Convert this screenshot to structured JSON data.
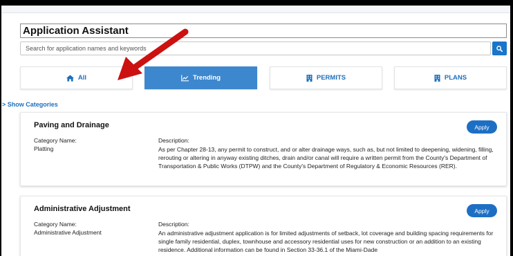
{
  "header": {
    "title": "Application Assistant"
  },
  "search": {
    "placeholder": "Search for application names and keywords"
  },
  "tabs": [
    {
      "label": "All",
      "icon": "home-icon"
    },
    {
      "label": "Trending",
      "icon": "chart-line-icon"
    },
    {
      "label": "PERMITS",
      "icon": "building-icon"
    },
    {
      "label": "PLANS",
      "icon": "building-icon"
    }
  ],
  "show_categories": "> Show Categories",
  "cards": [
    {
      "title": "Paving and Drainage",
      "apply_label": "Apply",
      "category_label": "Category Name:",
      "category_value": "Platting",
      "description_label": "Description:",
      "description": "As per Chapter 28-13, any permit to construct, and or alter drainage ways, such as, but not limited to deepening, widening, filling, rerouting or altering in anyway existing ditches, drain and/or canal will require a written permit from the County's Department of Transportation & Public Works (DTPW) and the County's Department of Regulatory & Economic Resources (RER)."
    },
    {
      "title": "Administrative Adjustment",
      "apply_label": "Apply",
      "category_label": "Category Name:",
      "category_value": "Administrative Adjustment",
      "description_label": "Description:",
      "description": "An administrative adjustment application is for limited adjustments of setback, lot coverage and building spacing requirements for single family residential, duplex, townhouse and accessory residential uses for new construction or an addition to an existing residence. Additional information can be found in Section 33-36.1 of the Miami-Dade"
    }
  ],
  "colors": {
    "accent": "#1d6fc4",
    "active_tab": "#3d87cf",
    "annotation_arrow": "#cc1111"
  }
}
